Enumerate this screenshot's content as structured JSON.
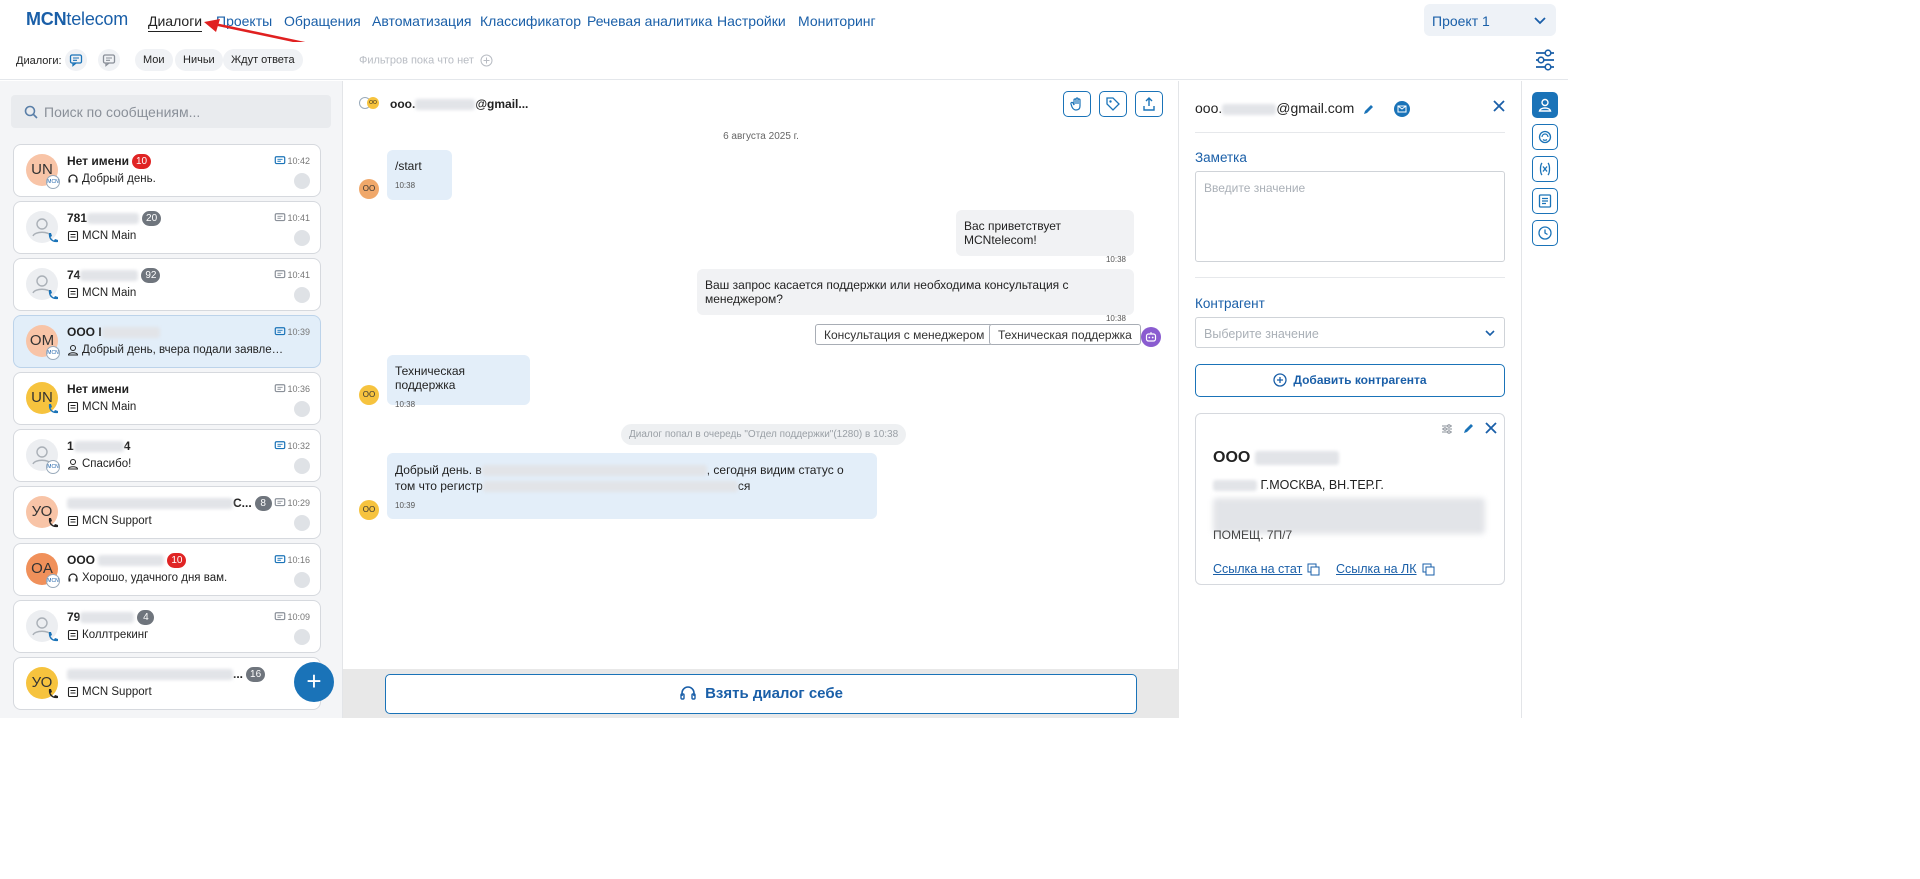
{
  "nav": {
    "logo_bold": "MCN",
    "logo_rest": "telecom",
    "items": [
      "Диалоги",
      "Проекты",
      "Обращения",
      "Автоматизация",
      "Классификатор",
      "Речевая аналитика",
      "Настройки",
      "Мониторинг"
    ],
    "project": "Проект 1"
  },
  "filters": {
    "label": "Диалоги:",
    "chips": [
      "Мои",
      "Ничьи",
      "Ждут ответа"
    ],
    "no_filters": "Фильтров пока что нет"
  },
  "search": {
    "placeholder": "Поиск по сообщениям..."
  },
  "dialogs": [
    {
      "initials": "UN",
      "name": "Нет имени",
      "count": "10",
      "count_color": "red",
      "time": "10:42",
      "message": "Добрый день.",
      "channel": "MCN"
    },
    {
      "initials": "",
      "name": "781",
      "count": "20",
      "count_color": "gray",
      "time": "10:41",
      "message": "MCN Main"
    },
    {
      "initials": "",
      "name": "74",
      "count": "92",
      "count_color": "gray",
      "time": "10:41",
      "message": "MCN Main"
    },
    {
      "initials": "OM",
      "name": "ООО I",
      "count": "",
      "time": "10:39",
      "message": "Добрый день, вчера подали заявлени...",
      "channel": "MCN"
    },
    {
      "initials": "UN",
      "name": "Нет имени",
      "count": "",
      "time": "10:36",
      "message": "MCN Main"
    },
    {
      "initials": "",
      "name": "1",
      "name_tail": "4",
      "count": "",
      "time": "10:32",
      "message": "Спасибо!",
      "channel": "MCN"
    },
    {
      "initials": "УО",
      "name": "",
      "name_tail": "С...",
      "count": "8",
      "count_color": "gray",
      "time": "10:29",
      "message": "MCN Support"
    },
    {
      "initials": "OA",
      "name": "ООО",
      "count": "10",
      "count_color": "red",
      "time": "10:16",
      "message": "Хорошо, удачного дня вам.",
      "channel": "MCN"
    },
    {
      "initials": "",
      "name": "79",
      "count": "4",
      "count_color": "gray",
      "time": "10:09",
      "message": "Коллтрекинг"
    },
    {
      "initials": "УО",
      "name": "",
      "name_tail": "...",
      "count": "16",
      "count_color": "gray",
      "time": "",
      "message": "MCN Support"
    }
  ],
  "chat": {
    "header_avatar": "OO",
    "title_prefix": "ооо.",
    "title_suffix": "@gmail...",
    "date": "6 августа 2025 г.",
    "messages": [
      {
        "text": "/start",
        "time": "10:38"
      },
      {
        "text": "Вас приветствует MCNtelecom!",
        "time": "10:38"
      },
      {
        "text": "Ваш запрос касается поддержки или необходима консультация с менеджером?",
        "time": "10:38"
      },
      {
        "text": "Техническая поддержка",
        "time": "10:38"
      },
      {
        "text_a": "Добрый день. в",
        "text_b": ", сегодня видим статус о",
        "text_c": "том что регистр",
        "text_d": "ся",
        "time": "10:39"
      }
    ],
    "quick_replies": [
      "Консультация с менеджером",
      "Техническая поддержка"
    ],
    "system": "Диалог попал в очередь \"Отдел поддержки\"(1280) в 10:38",
    "take_button": "Взять диалог себе",
    "avatar_label": "OO"
  },
  "right": {
    "title_prefix": "ооо.",
    "title_suffix": "@gmail.com",
    "note_label": "Заметка",
    "note_placeholder": "Введите значение",
    "contractor_label": "Контрагент",
    "contractor_placeholder": "Выберите значение",
    "add_button": "Добавить контрагента",
    "card": {
      "name": "ООО",
      "address": "Г.МОСКВА, ВН.ТЕР.Г.",
      "address2": "ПОМЕЩ. 7П/7",
      "link1": "Ссылка на стат",
      "link2": "Ссылка на ЛК"
    }
  }
}
